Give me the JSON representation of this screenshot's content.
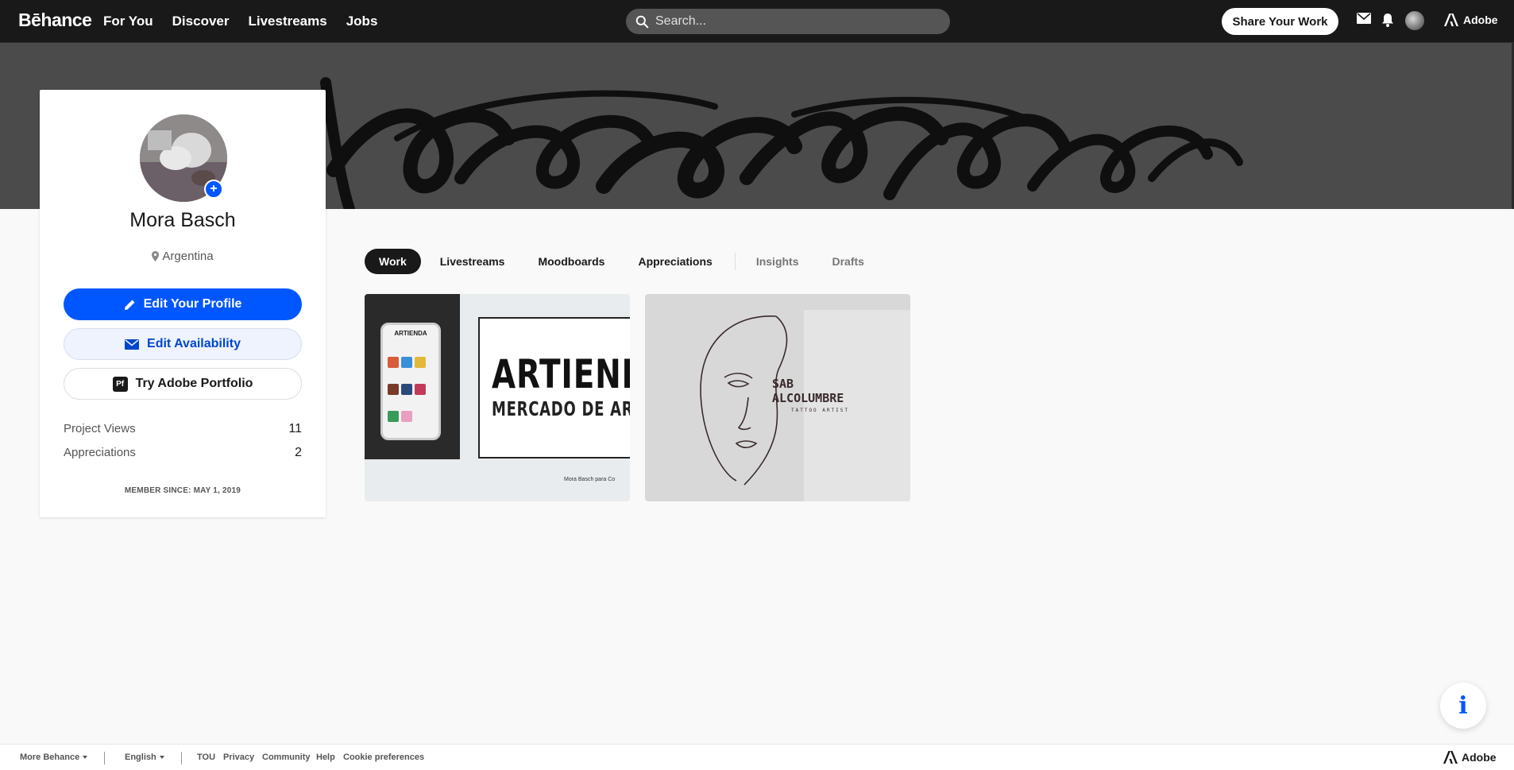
{
  "nav": {
    "logo": "Bēhance",
    "links": [
      "For You",
      "Discover",
      "Livestreams",
      "Jobs"
    ],
    "search_placeholder": "Search...",
    "share_label": "Share Your Work",
    "adobe_label": "Adobe"
  },
  "profile": {
    "name": "Mora Basch",
    "location": "Argentina",
    "edit_profile_label": "Edit Your Profile",
    "edit_availability_label": "Edit Availability",
    "portfolio_label": "Try Adobe Portfolio",
    "portfolio_badge": "Pf",
    "avatar_add": "+",
    "stats": [
      {
        "label": "Project Views",
        "value": "11"
      },
      {
        "label": "Appreciations",
        "value": "2"
      }
    ],
    "member_since": "MEMBER SINCE: MAY 1, 2019"
  },
  "tabs": {
    "work": "Work",
    "livestreams": "Livestreams",
    "moodboards": "Moodboards",
    "appreciations": "Appreciations",
    "insights": "Insights",
    "drafts": "Drafts"
  },
  "projects": [
    {
      "title": "ARTIENDA",
      "subtitle": "MERCADO DE ART",
      "credit": "Mora Basch para Co",
      "phone_title": "ARTIENDA"
    },
    {
      "title": "SAB\nALCOLUMBRE",
      "subtitle": "TATTOO ARTIST"
    }
  ],
  "info_fab": "i",
  "footer": {
    "more_behance": "More Behance",
    "language": "English",
    "links": [
      "TOU",
      "Privacy",
      "Community",
      "Help",
      "Cookie preferences"
    ],
    "adobe_label": "Adobe"
  },
  "colors": {
    "nav_bg": "#191919",
    "accent_blue": "#0057ff",
    "banner_bg": "#4b4b4b"
  }
}
